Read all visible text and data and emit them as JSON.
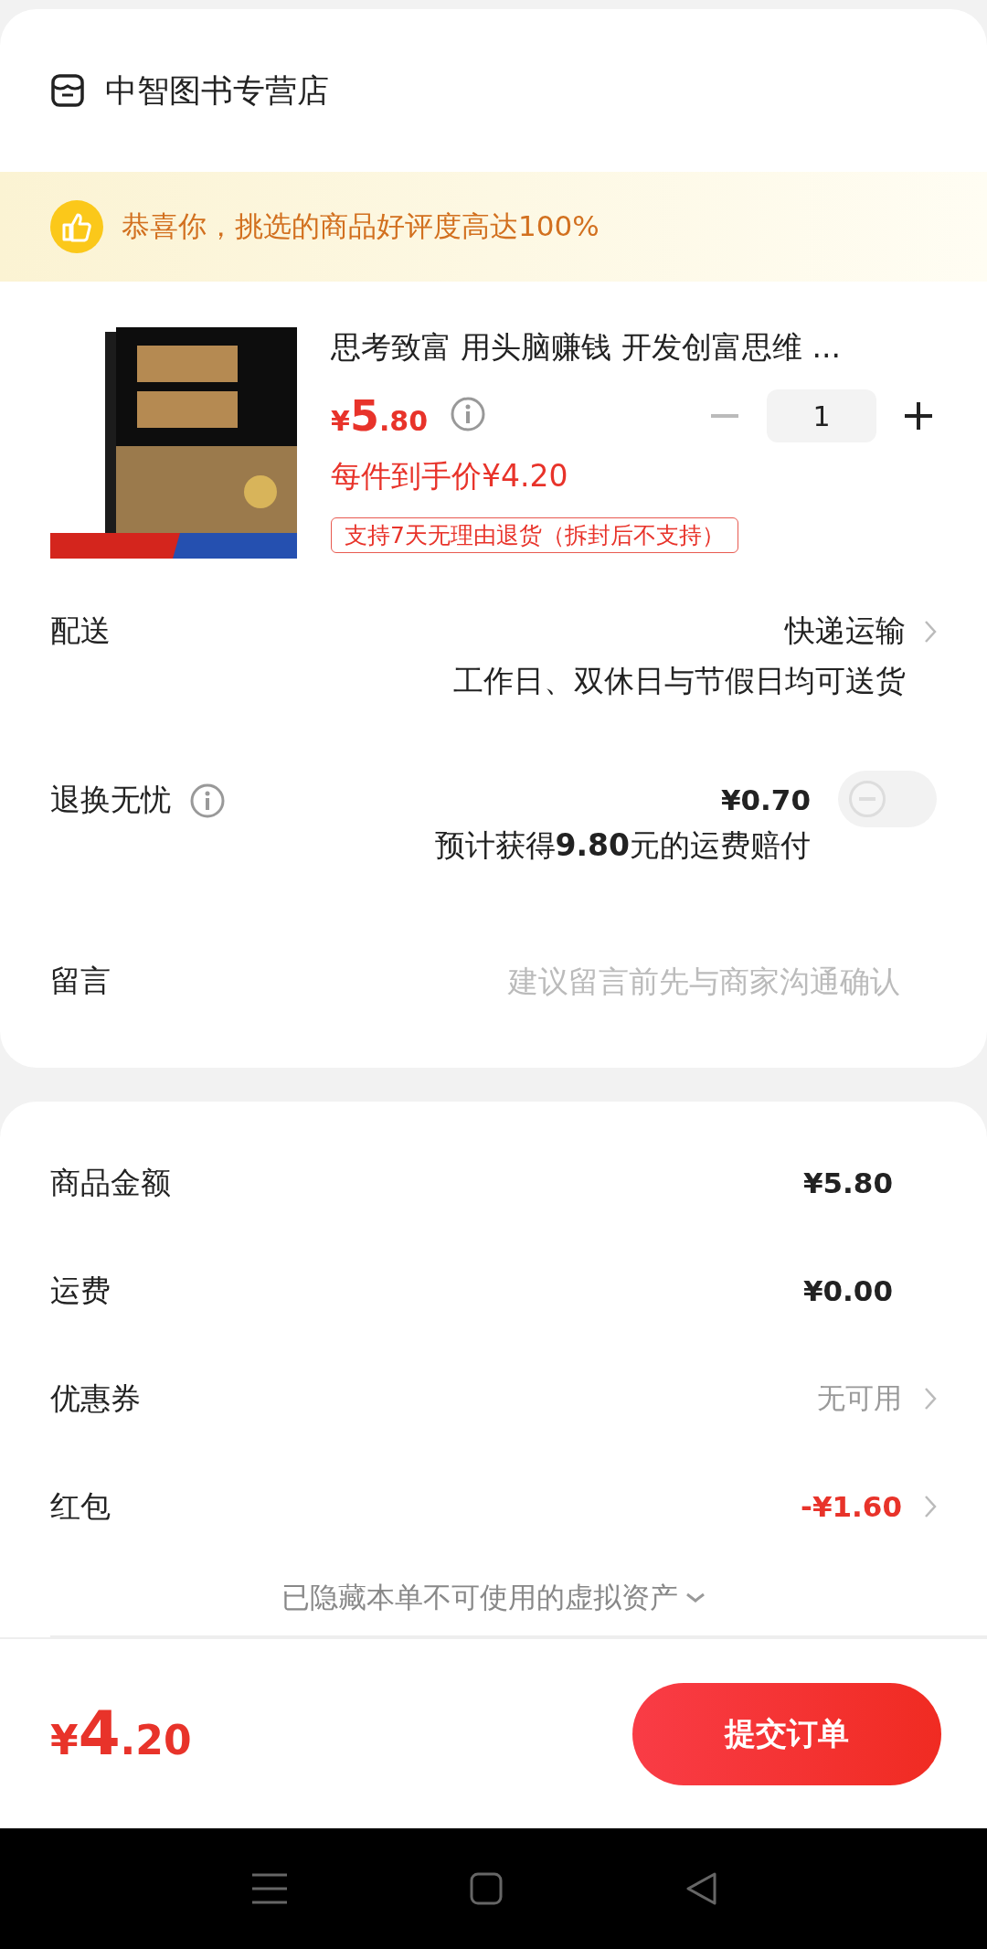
{
  "store": {
    "name": "中智图书专营店"
  },
  "banner": {
    "text": "恭喜你，挑选的商品好评度高达100%"
  },
  "product": {
    "title": "思考致富 用头脑赚钱 开发创富思维 ...",
    "price": {
      "symbol": "¥",
      "integer": "5",
      "decimal": ".80"
    },
    "unit_price": "每件到手价¥4.20",
    "quantity": "1",
    "minus_disabled": true,
    "tag": "支持7天无理由退货（拆封后不支持）"
  },
  "delivery": {
    "label": "配送",
    "value": "快递运输",
    "note": "工作日、双休日与节假日均可送货"
  },
  "return_insurance": {
    "label": "退换无忧",
    "price": "¥0.70",
    "note": "预计获得**9.80**元的运费赔付",
    "on": false
  },
  "message": {
    "label": "留言",
    "placeholder": "建议留言前先与商家沟通确认"
  },
  "summary": [
    {
      "label": "商品金额",
      "value": "¥5.80",
      "kind": "plain"
    },
    {
      "label": "运费",
      "value": "¥0.00",
      "kind": "plain"
    },
    {
      "label": "优惠券",
      "value": "无可用",
      "kind": "muted"
    },
    {
      "label": "红包",
      "value": "-¥1.60",
      "kind": "discount"
    }
  ],
  "hidden_assets": {
    "text": "已隐藏本单不可使用的虚拟资产"
  },
  "footer": {
    "total": {
      "symbol": "¥",
      "integer": "4",
      "decimal": ".20"
    },
    "submit": "提交订单"
  }
}
